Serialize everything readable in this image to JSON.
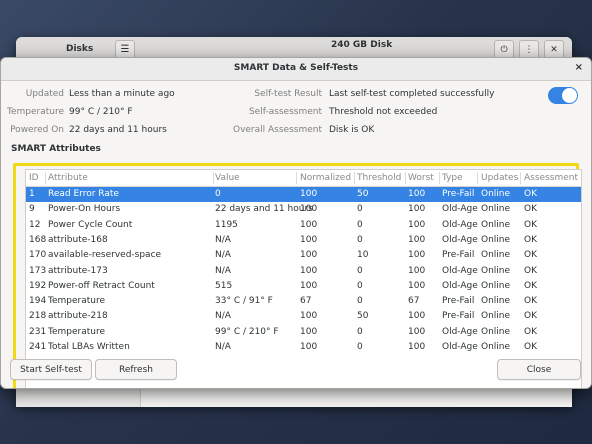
{
  "background_app": {
    "left_title": "Disks",
    "center_title": "240 GB Disk"
  },
  "dialog": {
    "title": "SMART Data & Self-Tests",
    "close_glyph": "×"
  },
  "info": {
    "updated_label": "Updated",
    "updated_value": "Less than a minute ago",
    "temperature_label": "Temperature",
    "temperature_value": "99° C / 210° F",
    "powered_on_label": "Powered On",
    "powered_on_value": "22 days and 11 hours",
    "self_test_label": "Self-test Result",
    "self_test_value": "Last self-test completed successfully",
    "self_assessment_label": "Self-assessment",
    "self_assessment_value": "Threshold not exceeded",
    "overall_label": "Overall Assessment",
    "overall_value": "Disk is OK"
  },
  "smart_enabled": true,
  "accent_color": "#3584e4",
  "highlight_color": "#f1d916",
  "section_title": "SMART Attributes",
  "table": {
    "headers": [
      "ID",
      "Attribute",
      "Value",
      "Normalized",
      "Threshold",
      "Worst",
      "Type",
      "Updates",
      "Assessment"
    ],
    "rows": [
      [
        "1",
        "Read Error Rate",
        "0",
        "100",
        "50",
        "100",
        "Pre-Fail",
        "Online",
        "OK"
      ],
      [
        "9",
        "Power-On Hours",
        "22 days and 11 hours",
        "100",
        "0",
        "100",
        "Old-Age",
        "Online",
        "OK"
      ],
      [
        "12",
        "Power Cycle Count",
        "1195",
        "100",
        "0",
        "100",
        "Old-Age",
        "Online",
        "OK"
      ],
      [
        "168",
        "attribute-168",
        "N/A",
        "100",
        "0",
        "100",
        "Old-Age",
        "Online",
        "OK"
      ],
      [
        "170",
        "available-reserved-space",
        "N/A",
        "100",
        "10",
        "100",
        "Pre-Fail",
        "Online",
        "OK"
      ],
      [
        "173",
        "attribute-173",
        "N/A",
        "100",
        "0",
        "100",
        "Old-Age",
        "Online",
        "OK"
      ],
      [
        "192",
        "Power-off Retract Count",
        "515",
        "100",
        "0",
        "100",
        "Old-Age",
        "Online",
        "OK"
      ],
      [
        "194",
        "Temperature",
        "33° C / 91° F",
        "67",
        "0",
        "67",
        "Pre-Fail",
        "Online",
        "OK"
      ],
      [
        "218",
        "attribute-218",
        "N/A",
        "100",
        "50",
        "100",
        "Pre-Fail",
        "Online",
        "OK"
      ],
      [
        "231",
        "Temperature",
        "99° C / 210° F",
        "100",
        "0",
        "100",
        "Old-Age",
        "Online",
        "OK"
      ],
      [
        "241",
        "Total LBAs Written",
        "N/A",
        "100",
        "0",
        "100",
        "Old-Age",
        "Online",
        "OK"
      ]
    ],
    "selected_row": 0
  },
  "buttons": {
    "start_self_test": "Start Self-test",
    "refresh": "Refresh",
    "close": "Close"
  }
}
